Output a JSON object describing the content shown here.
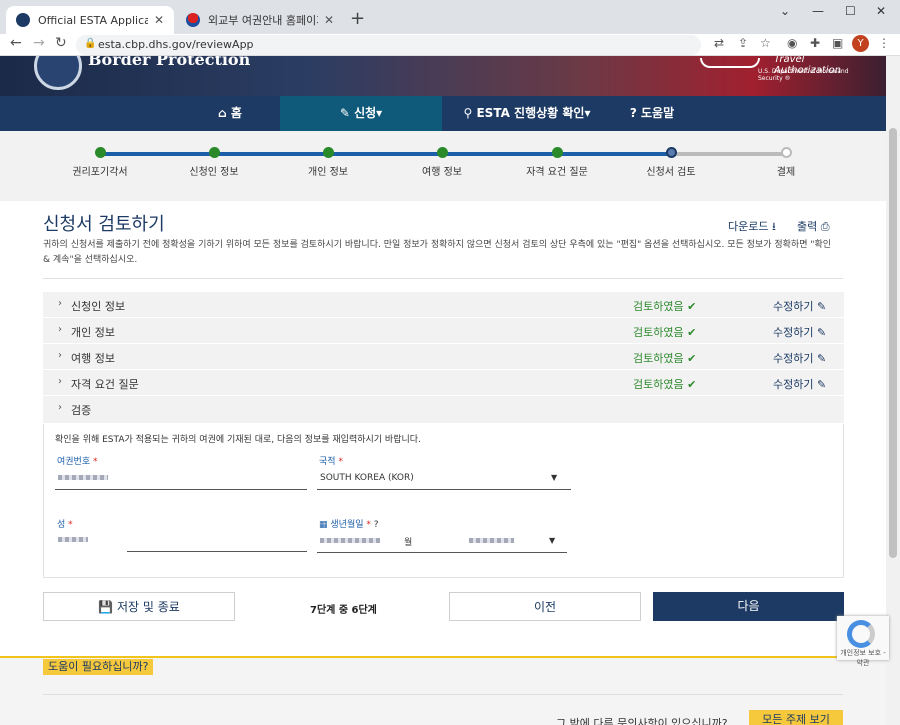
{
  "browser": {
    "tabs": [
      {
        "title": "Official ESTA Application Websi",
        "active": true
      },
      {
        "title": "외교부 여권안내 홈페이지",
        "active": false
      }
    ],
    "url": "esta.cbp.dhs.gov/reviewApp",
    "profile_initial": "Y",
    "window_controls": [
      "⌄",
      "—",
      "☐",
      "✕"
    ]
  },
  "banner": {
    "left_text": "Border Protection",
    "right_text": "Travel Authorization",
    "right_subtext": "U.S. Department of Homeland Security ®"
  },
  "nav": {
    "items": [
      {
        "label": "홈",
        "icon": "home-icon"
      },
      {
        "label": "신청▾",
        "icon": "pencil-icon",
        "active": true
      },
      {
        "label": "ESTA 진행상황 확인▾",
        "icon": "search-icon"
      },
      {
        "label": "도움말",
        "icon": "help-circle-icon"
      }
    ]
  },
  "progress": {
    "steps": [
      "권리포기각서",
      "신청인 정보",
      "개인 정보",
      "여행 정보",
      "자격 요건 질문",
      "신청서 검토",
      "결제"
    ],
    "current_index": 5,
    "colors": {
      "done": "#2a8a2a",
      "current": "#1c3a63",
      "pending": "#bbbbbb",
      "line_done": "#1c5ea8"
    }
  },
  "review": {
    "title": "신청서 검토하기",
    "download_label": "다운로드",
    "print_label": "출력",
    "intro": "귀하의 신청서를 제출하기 전에 정확성을 기하기 위하여 모든 정보를 검토하시기 바랍니다. 만일 정보가 정확하지 않으면 신청서 검토의 상단 우측에 있는 \"편집\" 옵션을 선택하십시오. 모든 정보가 정확하면 \"확인 & 계속\"을 선택하십시오.",
    "sections": [
      {
        "name": "신청인 정보",
        "status": "검토하였음",
        "edit": "수정하기"
      },
      {
        "name": "개인 정보",
        "status": "검토하였음",
        "edit": "수정하기"
      },
      {
        "name": "여행 정보",
        "status": "검토하였음",
        "edit": "수정하기"
      },
      {
        "name": "자격 요건 질문",
        "status": "검토하였음",
        "edit": "수정하기"
      },
      {
        "name": "검증",
        "status": "",
        "edit": ""
      }
    ],
    "verify": {
      "description": "확인을 위해 ESTA가 적용되는 귀하의 여권에 기재된 대로, 다음의 정보를 재입력하시기 바랍니다.",
      "passport_label": "여권번호",
      "country_label": "국적",
      "country_value": "SOUTH KOREA (KOR)",
      "surname_label": "성",
      "dob_label": "생년월일",
      "dob_month_suffix": "월"
    }
  },
  "actions": {
    "save_label": "저장 및 종료",
    "step_text": "7단계 중 6단계",
    "prev_label": "이전",
    "next_label": "다음"
  },
  "footer": {
    "help_label": "도움이 필요하십니까?",
    "question": "그 밖에 다른 문의사항이 있으십니까?",
    "faq_label": "모든 주제 보기",
    "recaptcha_text": "개인정보 보호 - 약관"
  }
}
